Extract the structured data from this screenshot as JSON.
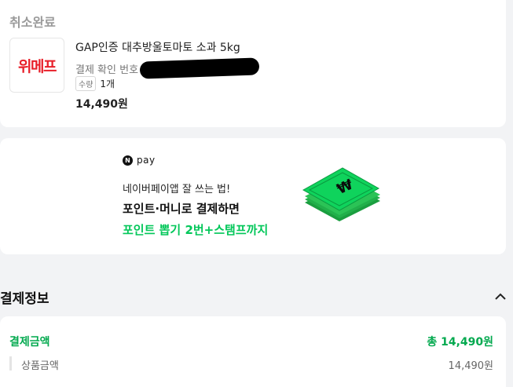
{
  "order": {
    "status": "취소완료",
    "store_logo": "위메프",
    "product_name": "GAP인증 대추방울토마토 소과 5kg",
    "confirm_label": "결제 확인 번호",
    "quantity_label": "수량",
    "quantity_value": "1개",
    "price": "14,490원"
  },
  "npay_banner": {
    "badge_n": "N",
    "badge_text": "pay",
    "line1": "네이버페이앱 잘 쓰는 법!",
    "line2": "포인트·머니로 결제하면",
    "line3": "포인트 뽑기 2번+스탬프까지",
    "accent_color": "#03c75a",
    "art_icon": "money-stack-icon"
  },
  "payment_info": {
    "title": "결제정보",
    "collapse_icon": "chevron-up-icon",
    "amount_label": "결제금액",
    "amount_total": "총 14,490원",
    "product_amount_label": "상품금액",
    "product_amount_value": "14,490원",
    "accent_color": "#03a94f"
  }
}
